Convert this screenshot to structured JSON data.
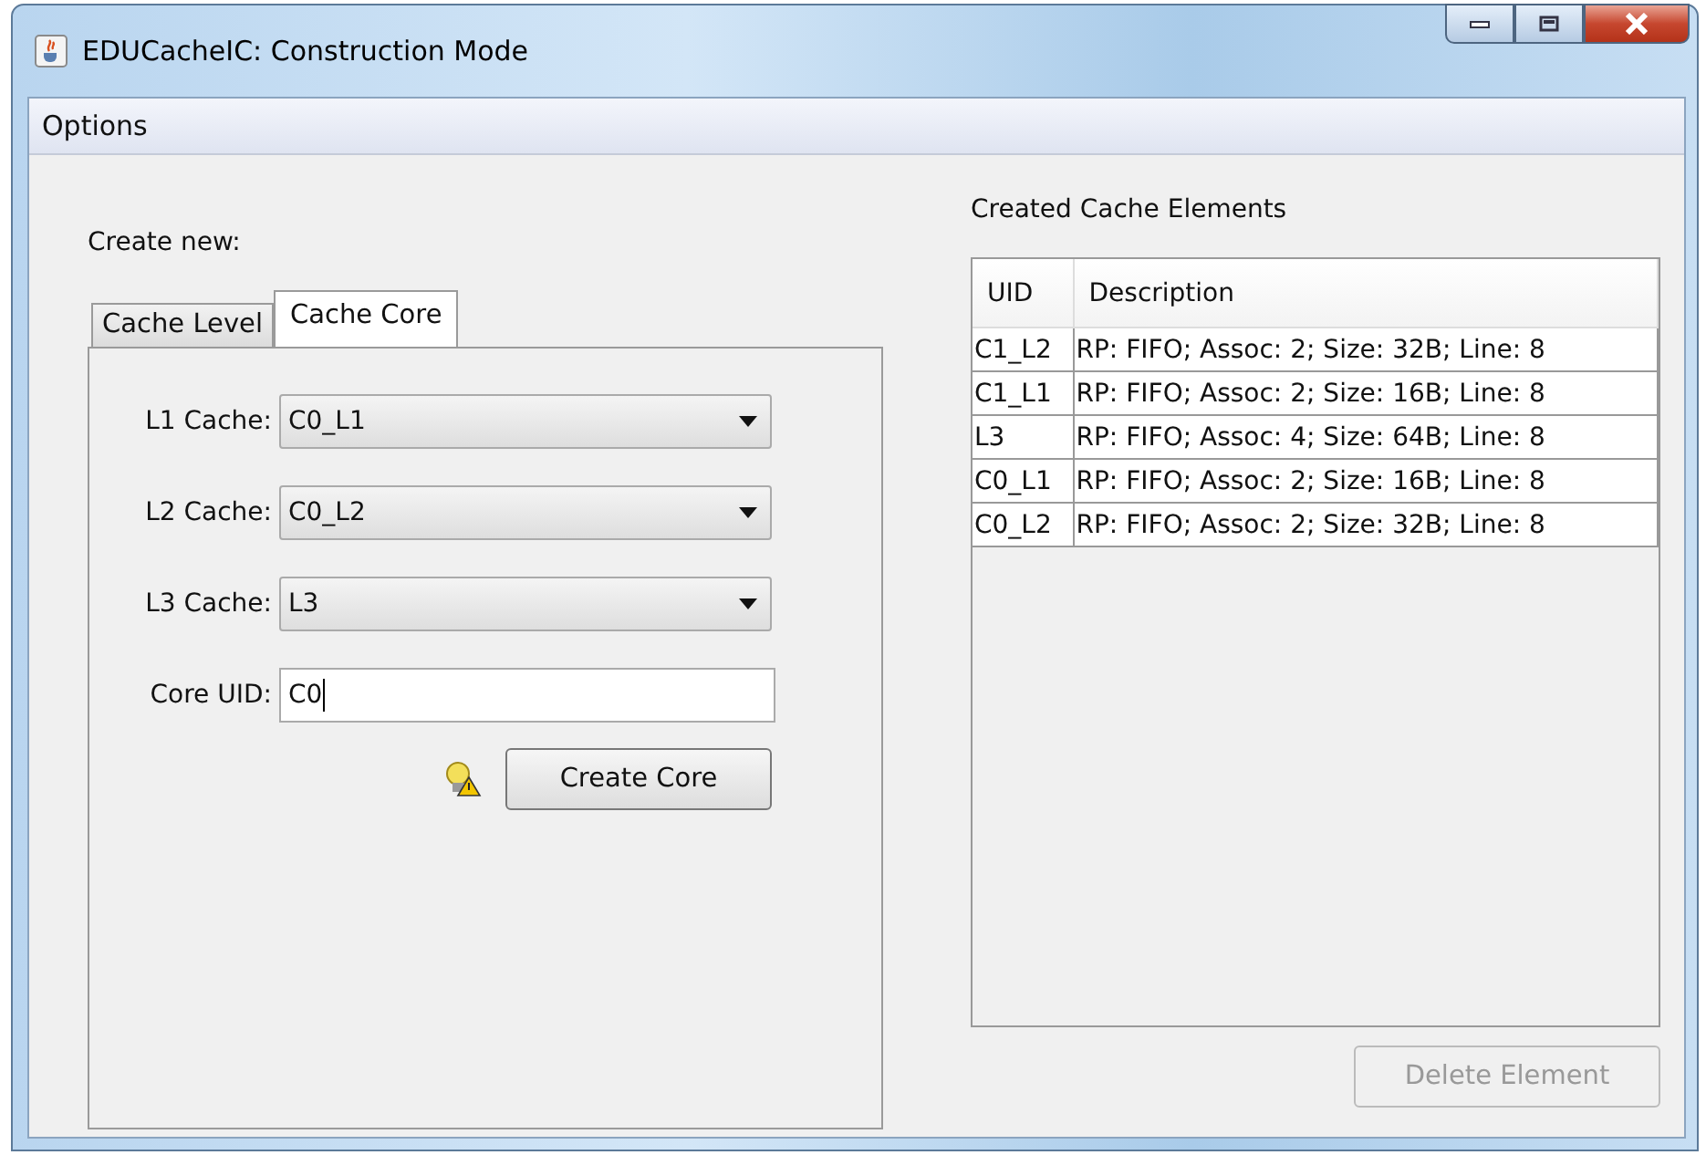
{
  "window": {
    "title": "EDUCacheIC: Construction Mode"
  },
  "menu": [
    "Options"
  ],
  "create_panel": {
    "label": "Create new:",
    "tabs": [
      {
        "label": "Cache Level",
        "selected": false
      },
      {
        "label": "Cache Core",
        "selected": true
      }
    ],
    "fields": [
      {
        "kind": "combo",
        "label": "L1 Cache:",
        "value": "C0_L1"
      },
      {
        "kind": "combo",
        "label": "L2 Cache:",
        "value": "C0_L2"
      },
      {
        "kind": "combo",
        "label": "L3 Cache:",
        "value": "L3"
      },
      {
        "kind": "text",
        "label": "Core UID:",
        "value": "C0"
      }
    ],
    "button": {
      "label": "Create Core",
      "disabled": false
    }
  },
  "elements_panel": {
    "label": "Created Cache Elements",
    "table": {
      "columns": [
        "UID",
        "Description"
      ],
      "rows": [
        [
          "C1_L2",
          "RP: FIFO; Assoc: 2; Size: 32B; Line: 8"
        ],
        [
          "C1_L1",
          "RP: FIFO; Assoc: 2; Size: 16B; Line: 8"
        ],
        [
          "L3",
          "RP: FIFO; Assoc: 4; Size: 64B; Line: 8"
        ],
        [
          "C0_L1",
          "RP: FIFO; Assoc: 2; Size: 16B; Line: 8"
        ],
        [
          "C0_L2",
          "RP: FIFO; Assoc: 2; Size: 32B; Line: 8"
        ]
      ]
    },
    "button": {
      "label": "Delete Element",
      "disabled": true
    }
  }
}
